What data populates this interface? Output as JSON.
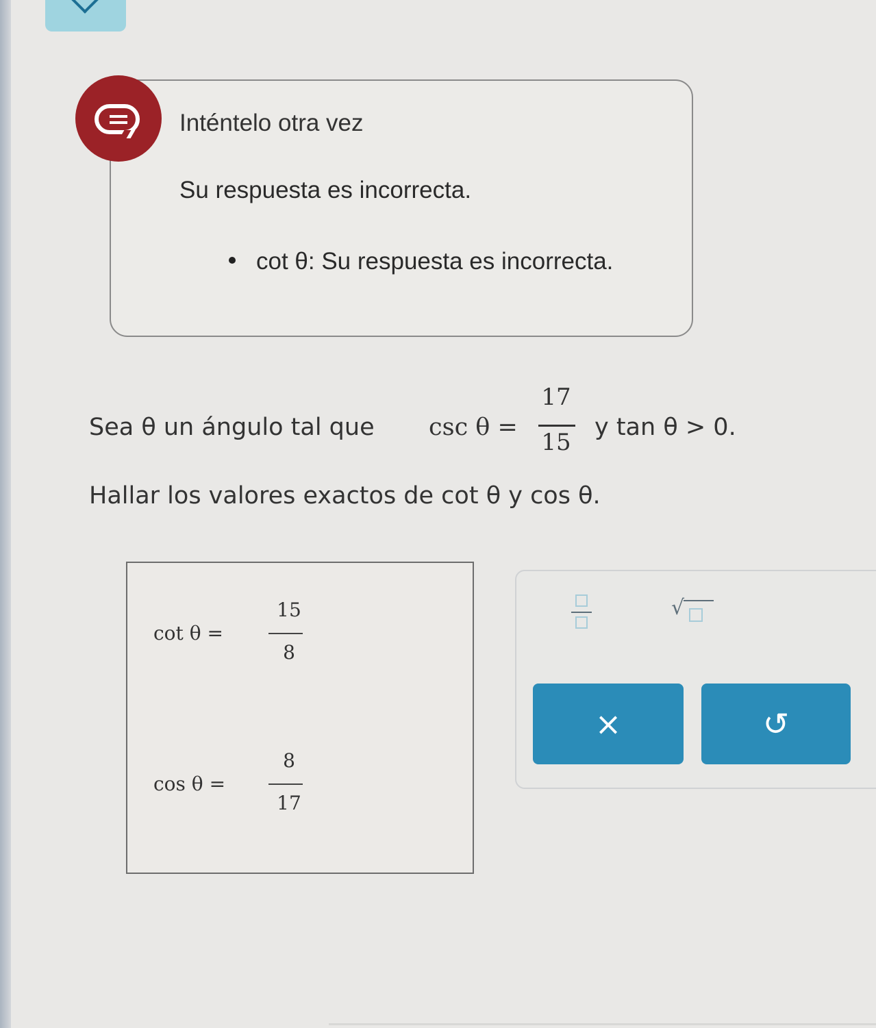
{
  "feedback": {
    "title": "Inténtelo otra vez",
    "message": "Su respuesta es incorrecta.",
    "items": [
      {
        "label": "cot θ: Su respuesta es incorrecta."
      }
    ],
    "badge_color": "#9b2227"
  },
  "problem": {
    "line1_prefix": "Sea θ un ángulo tal que",
    "csc_label": "csc θ =",
    "csc_numerator": "17",
    "csc_denominator": "15",
    "line1_suffix": "y tan θ > 0.",
    "line2": "Hallar los valores exactos de cot θ y cos θ."
  },
  "answers": {
    "cot": {
      "label": "cot θ =",
      "numerator": "15",
      "denominator": "8"
    },
    "cos": {
      "label": "cos θ =",
      "numerator": "8",
      "denominator": "17"
    }
  },
  "palette": {
    "fraction_button": "fraction-template",
    "sqrt_button": "square-root-template",
    "clear_label": "×",
    "undo_label": "↺",
    "button_color": "#2b8cb8"
  }
}
